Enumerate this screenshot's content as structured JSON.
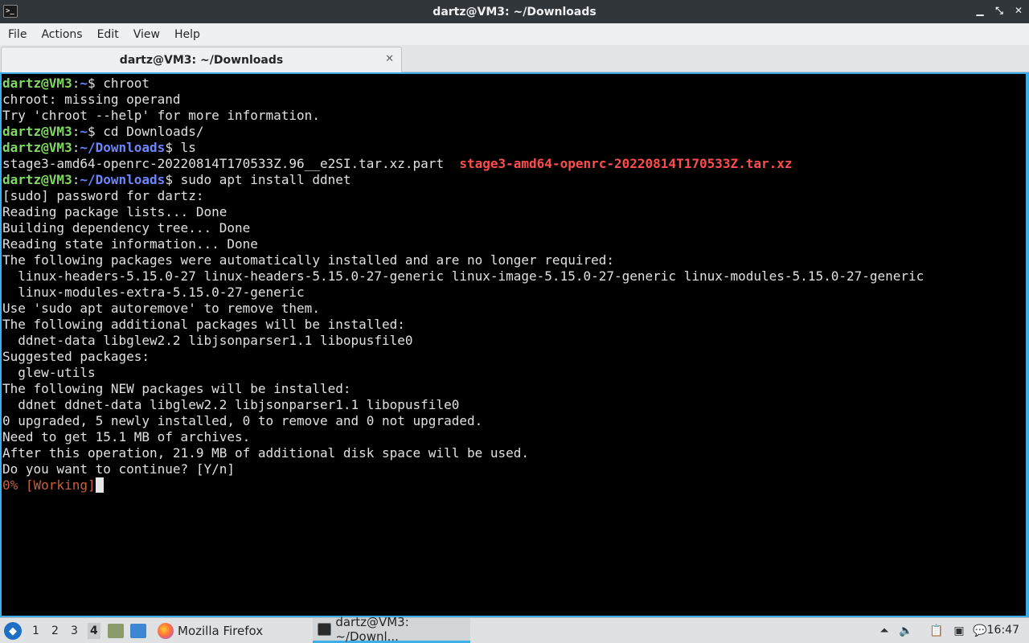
{
  "window": {
    "title": "dartz@VM3: ~/Downloads",
    "icon": "terminal-icon"
  },
  "menu": {
    "items": [
      "File",
      "Actions",
      "Edit",
      "View",
      "Help"
    ]
  },
  "tab": {
    "label": "dartz@VM3: ~/Downloads",
    "close_glyph": "✕"
  },
  "terminal": {
    "prompt_user": "dartz@VM3",
    "lines": [
      {
        "type": "prompt",
        "path": "~",
        "cmd": " chroot"
      },
      {
        "type": "text",
        "text": "chroot: missing operand"
      },
      {
        "type": "text",
        "text": "Try 'chroot --help' for more information."
      },
      {
        "type": "prompt",
        "path": "~",
        "cmd": " cd Downloads/"
      },
      {
        "type": "prompt",
        "path": "~/Downloads",
        "cmd": " ls"
      },
      {
        "type": "ls",
        "file1": "stage3-amd64-openrc-20220814T170533Z.96__e2SI.tar.xz.part",
        "sep": "  ",
        "file2": "stage3-amd64-openrc-20220814T170533Z.tar.xz"
      },
      {
        "type": "prompt",
        "path": "~/Downloads",
        "cmd": " sudo apt install ddnet"
      },
      {
        "type": "text",
        "text": "[sudo] password for dartz:"
      },
      {
        "type": "text",
        "text": "Reading package lists... Done"
      },
      {
        "type": "text",
        "text": "Building dependency tree... Done"
      },
      {
        "type": "text",
        "text": "Reading state information... Done"
      },
      {
        "type": "text",
        "text": "The following packages were automatically installed and are no longer required:"
      },
      {
        "type": "text",
        "text": "  linux-headers-5.15.0-27 linux-headers-5.15.0-27-generic linux-image-5.15.0-27-generic linux-modules-5.15.0-27-generic"
      },
      {
        "type": "text",
        "text": "  linux-modules-extra-5.15.0-27-generic"
      },
      {
        "type": "text",
        "text": "Use 'sudo apt autoremove' to remove them."
      },
      {
        "type": "text",
        "text": "The following additional packages will be installed:"
      },
      {
        "type": "text",
        "text": "  ddnet-data libglew2.2 libjsonparser1.1 libopusfile0"
      },
      {
        "type": "text",
        "text": "Suggested packages:"
      },
      {
        "type": "text",
        "text": "  glew-utils"
      },
      {
        "type": "text",
        "text": "The following NEW packages will be installed:"
      },
      {
        "type": "text",
        "text": "  ddnet ddnet-data libglew2.2 libjsonparser1.1 libopusfile0"
      },
      {
        "type": "text",
        "text": "0 upgraded, 5 newly installed, 0 to remove and 0 not upgraded."
      },
      {
        "type": "text",
        "text": "Need to get 15.1 MB of archives."
      },
      {
        "type": "text",
        "text": "After this operation, 21.9 MB of additional disk space will be used."
      },
      {
        "type": "text",
        "text": "Do you want to continue? [Y/n]"
      },
      {
        "type": "progress",
        "text": "0% [Working]"
      }
    ]
  },
  "taskbar": {
    "workspaces": [
      "1",
      "2",
      "3",
      "4"
    ],
    "active_workspace": "4",
    "tasks": [
      {
        "label": "Mozilla Firefox",
        "icon": "firefox-icon"
      },
      {
        "label": "dartz@VM3: ~/Downl...",
        "icon": "terminal-icon"
      }
    ],
    "clock": "16:47"
  },
  "colors": {
    "prompt_user": "#7fd962",
    "prompt_path": "#6b86ff",
    "archive_file": "#ff4c4c",
    "progress": "#c8603a",
    "accent": "#3daee9"
  }
}
